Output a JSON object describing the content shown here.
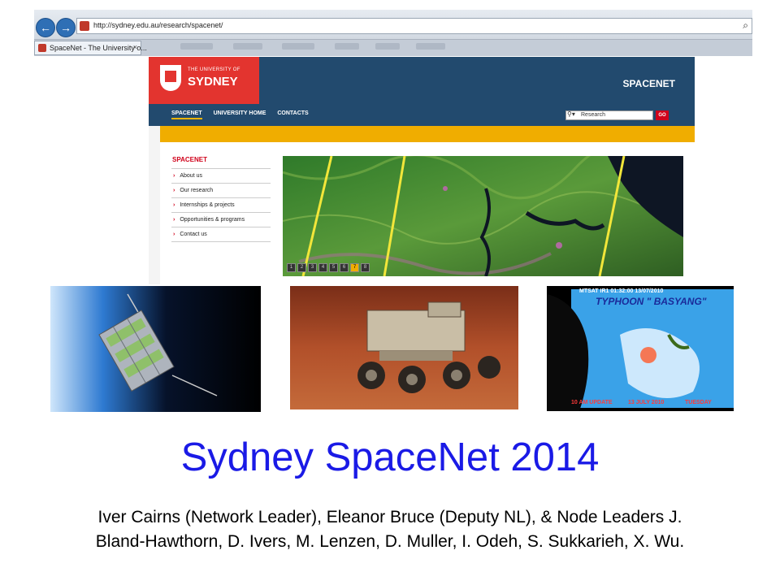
{
  "browser": {
    "back_symbol": "←",
    "forward_symbol": "→",
    "url": "http://sydney.edu.au/research/spacenet/",
    "tab_title": "SpaceNet - The University o...",
    "tab_close": "×"
  },
  "site": {
    "logo_small": "THE UNIVERSITY OF",
    "logo_big": "SYDNEY",
    "name": "SPACENET",
    "nav": [
      "SPACENET",
      "UNIVERSITY HOME",
      "CONTACTS"
    ],
    "search_value": "Research",
    "go_label": "GO",
    "sidebar_title": "SPACENET",
    "sidebar_items": [
      "About us",
      "Our research",
      "Internships & projects",
      "Opportunities & programs",
      "Contact us"
    ],
    "slider_pages": [
      "1",
      "2",
      "3",
      "4",
      "5",
      "6",
      "7",
      "8"
    ]
  },
  "photos": {
    "typhoon_label": "TYPHOON \" BASYANG\"",
    "sat_header": "MTSAT IR1 01:32:00 13/07/2010",
    "update_text": "10 AM UPDATE",
    "date_text": "13 JULY 2010",
    "day_text": "TUESDAY"
  },
  "slide": {
    "title": "Sydney SpaceNet 2014",
    "authors_line1": "Iver Cairns (Network Leader), Eleanor Bruce (Deputy NL), & Node Leaders J.",
    "authors_line2": "Bland-Hawthorn, D. Ivers, M. Lenzen, D. Muller, I. Odeh, S. Sukkarieh, X. Wu."
  },
  "colors": {
    "title_blue": "#1a1ae6",
    "header_navy": "#224a6e",
    "brand_red": "#e3342f",
    "accent_gold": "#f0ad00"
  }
}
